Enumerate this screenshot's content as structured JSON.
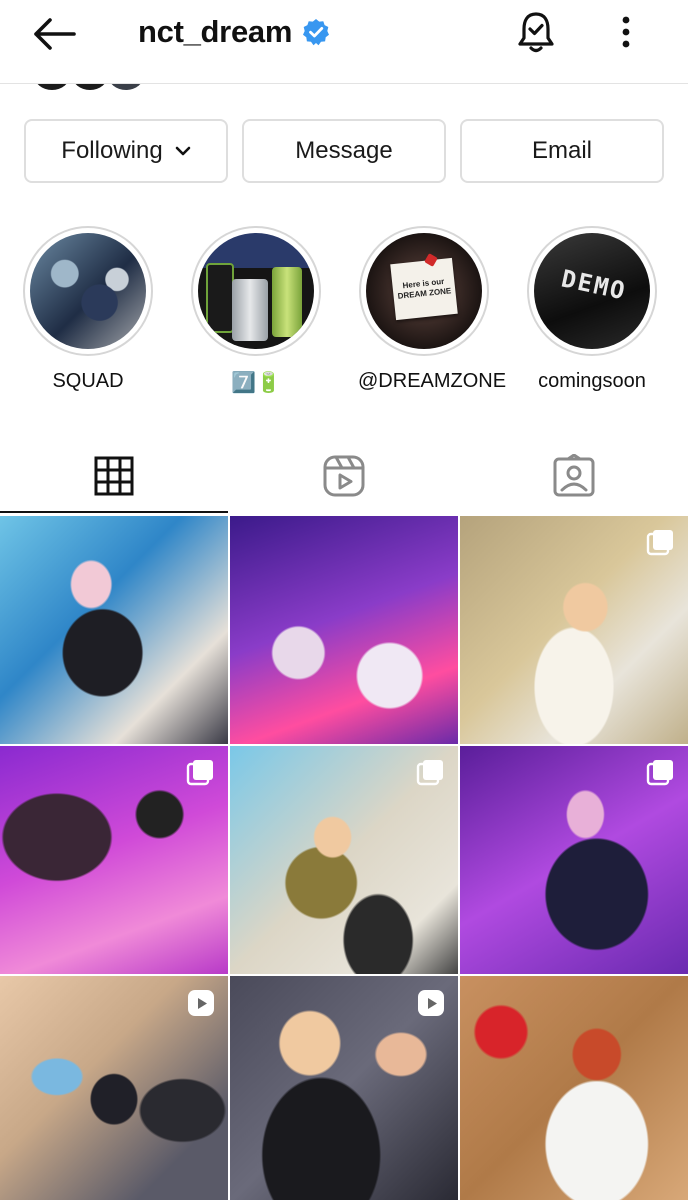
{
  "header": {
    "username": "nct_dream",
    "back_icon": "arrow-left-icon",
    "verified_icon": "verified-badge-icon",
    "notification_icon": "bell-check-icon",
    "more_icon": "more-vertical-icon"
  },
  "actions": {
    "following_label": "Following",
    "message_label": "Message",
    "email_label": "Email"
  },
  "highlights": [
    {
      "label": "SQUAD"
    },
    {
      "label": "7️⃣🔋"
    },
    {
      "label": "@DREAMZONE"
    },
    {
      "label": "comingsoon"
    }
  ],
  "highlight_texts": {
    "dreamzone_card": "Here is our DREAM ZONE",
    "demo_sign": "DEMO"
  },
  "tabs": [
    {
      "icon": "grid-icon",
      "active": true
    },
    {
      "icon": "reels-icon",
      "active": false
    },
    {
      "icon": "tagged-icon",
      "active": false
    }
  ],
  "posts": [
    {
      "type": "photo"
    },
    {
      "type": "photo"
    },
    {
      "type": "carousel"
    },
    {
      "type": "carousel"
    },
    {
      "type": "carousel"
    },
    {
      "type": "carousel"
    },
    {
      "type": "reel"
    },
    {
      "type": "reel"
    },
    {
      "type": "photo"
    }
  ],
  "colors": {
    "verified_blue": "#3897f0",
    "border": "#dedede",
    "text": "#111111"
  }
}
